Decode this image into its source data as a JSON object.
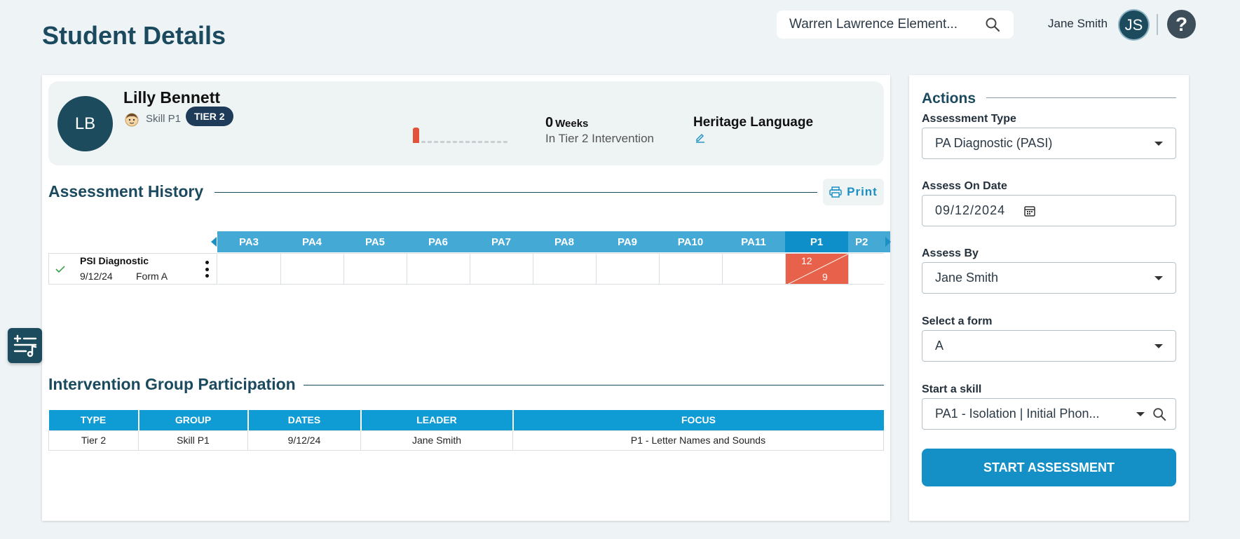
{
  "page": {
    "title": "Student Details"
  },
  "header": {
    "school_search_value": "Warren Lawrence Element...",
    "user_name": "Jane Smith",
    "user_initials": "JS",
    "help_label": "?"
  },
  "student": {
    "initials": "LB",
    "name": "Lilly Bennett",
    "skill": "Skill P1",
    "tier_badge": "TIER 2",
    "weeks_count": "0",
    "weeks_unit": "Weeks",
    "weeks_caption": "In Tier 2 Intervention",
    "heritage_language_label": "Heritage Language"
  },
  "assessment_history": {
    "title": "Assessment History",
    "print_label": "Print",
    "columns": [
      "PA3",
      "PA4",
      "PA5",
      "PA6",
      "PA7",
      "PA8",
      "PA9",
      "PA10",
      "PA11",
      "P1",
      "P2"
    ],
    "active_column": "P1",
    "rows": [
      {
        "name": "PSI Diagnostic",
        "date": "9/12/24",
        "form": "Form A",
        "scores": {
          "P1": {
            "top": "12",
            "bottom": "9"
          }
        }
      }
    ]
  },
  "intervention": {
    "title": "Intervention Group Participation",
    "headers": [
      "TYPE",
      "GROUP",
      "DATES",
      "LEADER",
      "FOCUS"
    ],
    "rows": [
      [
        "Tier 2",
        "Skill P1",
        "9/12/24",
        "Jane Smith",
        "P1 - Letter Names and Sounds"
      ]
    ]
  },
  "actions": {
    "title": "Actions",
    "assessment_type_label": "Assessment Type",
    "assessment_type_value": "PA Diagnostic (PASI)",
    "assess_on_date_label": "Assess On Date",
    "assess_on_date_value": "09/12/2024",
    "assess_by_label": "Assess By",
    "assess_by_value": "Jane Smith",
    "select_form_label": "Select a form",
    "select_form_value": "A",
    "start_skill_label": "Start a skill",
    "start_skill_value": "PA1 - Isolation | Initial Phon...",
    "start_button_label": "START ASSESSMENT"
  },
  "colors": {
    "brand_dark": "#1b4a5e",
    "accent_blue": "#0f9bd3",
    "score_red": "#e8614b",
    "tier_badge": "#1f3b5a"
  }
}
